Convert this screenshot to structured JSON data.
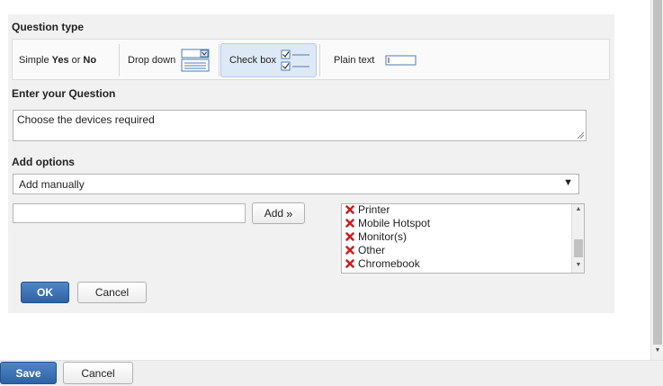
{
  "question_type": {
    "title": "Question type",
    "simple": {
      "prefix": "Simple",
      "yes": "Yes",
      "or": "or",
      "no": "No"
    },
    "dropdown_label": "Drop down",
    "checkbox_label": "Check box",
    "plaintext_label": "Plain text",
    "selected": "Check box"
  },
  "question": {
    "title": "Enter your Question",
    "value": "Choose the devices required"
  },
  "add_options": {
    "title": "Add options",
    "mode": "Add manually",
    "input_value": "",
    "add_button": "Add",
    "items": [
      "Printer",
      "Mobile Hotspot",
      "Monitor(s)",
      "Other",
      "Chromebook"
    ]
  },
  "dialog": {
    "ok": "OK",
    "cancel": "Cancel"
  },
  "footer": {
    "save": "Save",
    "cancel": "Cancel"
  },
  "colors": {
    "primary_button": "#2e62a5",
    "selected_type": "#dde9f6",
    "remove_icon": "#cc1f1f"
  }
}
